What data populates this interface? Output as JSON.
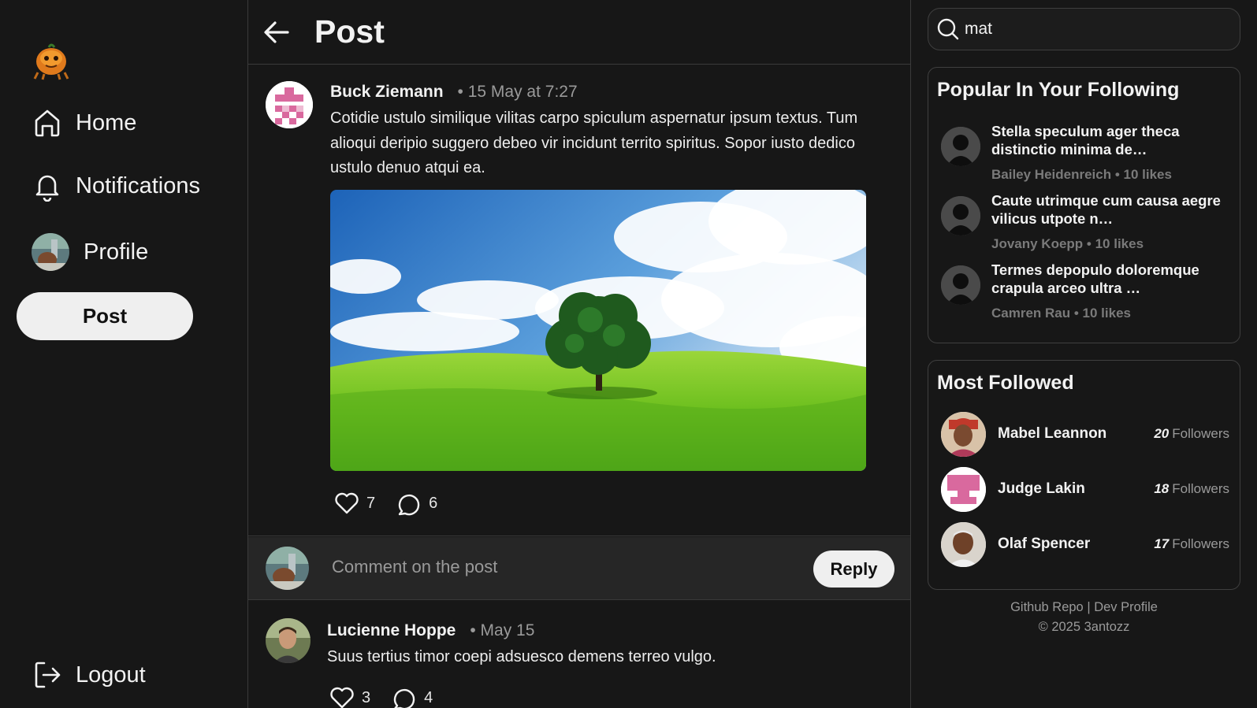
{
  "nav": {
    "home": "Home",
    "notifications": "Notifications",
    "profile": "Profile",
    "post_button": "Post",
    "logout": "Logout"
  },
  "header": {
    "title": "Post"
  },
  "post": {
    "author": "Buck Ziemann",
    "time": "• 15 May at 7:27",
    "body": "Cotidie ustulo similique vilitas carpo spiculum aspernatur ipsum textus. Tum alioqui deripio suggero debeo vir incidunt territo spiritus. Sopor iusto dedico ustulo denuo atqui ea.",
    "likes": "7",
    "comments": "6"
  },
  "comment_box": {
    "placeholder": "Comment on the post",
    "reply_label": "Reply"
  },
  "reply": {
    "author": "Lucienne Hoppe",
    "time": "• May 15",
    "body": "Suus tertius timor coepi adsuesco demens terreo vulgo.",
    "likes": "3",
    "comments": "4"
  },
  "search": {
    "value": "mat"
  },
  "popular": {
    "title": "Popular In Your Following",
    "items": [
      {
        "text": "Stella speculum ager theca distinctio minima de…",
        "sub": "Bailey Heidenreich • 10 likes"
      },
      {
        "text": "Caute utrimque cum causa aegre vilicus utpote n…",
        "sub": "Jovany Koepp • 10 likes"
      },
      {
        "text": "Termes depopulo doloremque crapula arceo ultra …",
        "sub": "Camren Rau • 10 likes"
      }
    ]
  },
  "most_followed": {
    "title": "Most Followed",
    "items": [
      {
        "name": "Mabel Leannon",
        "count": "20",
        "label": "Followers"
      },
      {
        "name": "Judge Lakin",
        "count": "18",
        "label": "Followers"
      },
      {
        "name": "Olaf Spencer",
        "count": "17",
        "label": "Followers"
      }
    ]
  },
  "footer": {
    "repo": "Github Repo",
    "separator": "|",
    "dev": "Dev Profile",
    "copyright": "© 2025 3antozz"
  },
  "colors": {
    "background": "#171717",
    "border": "#3a3a3a",
    "button_bg": "#efefef",
    "muted_text": "#9a9a9a",
    "identicon_pink": "#d9699e"
  }
}
